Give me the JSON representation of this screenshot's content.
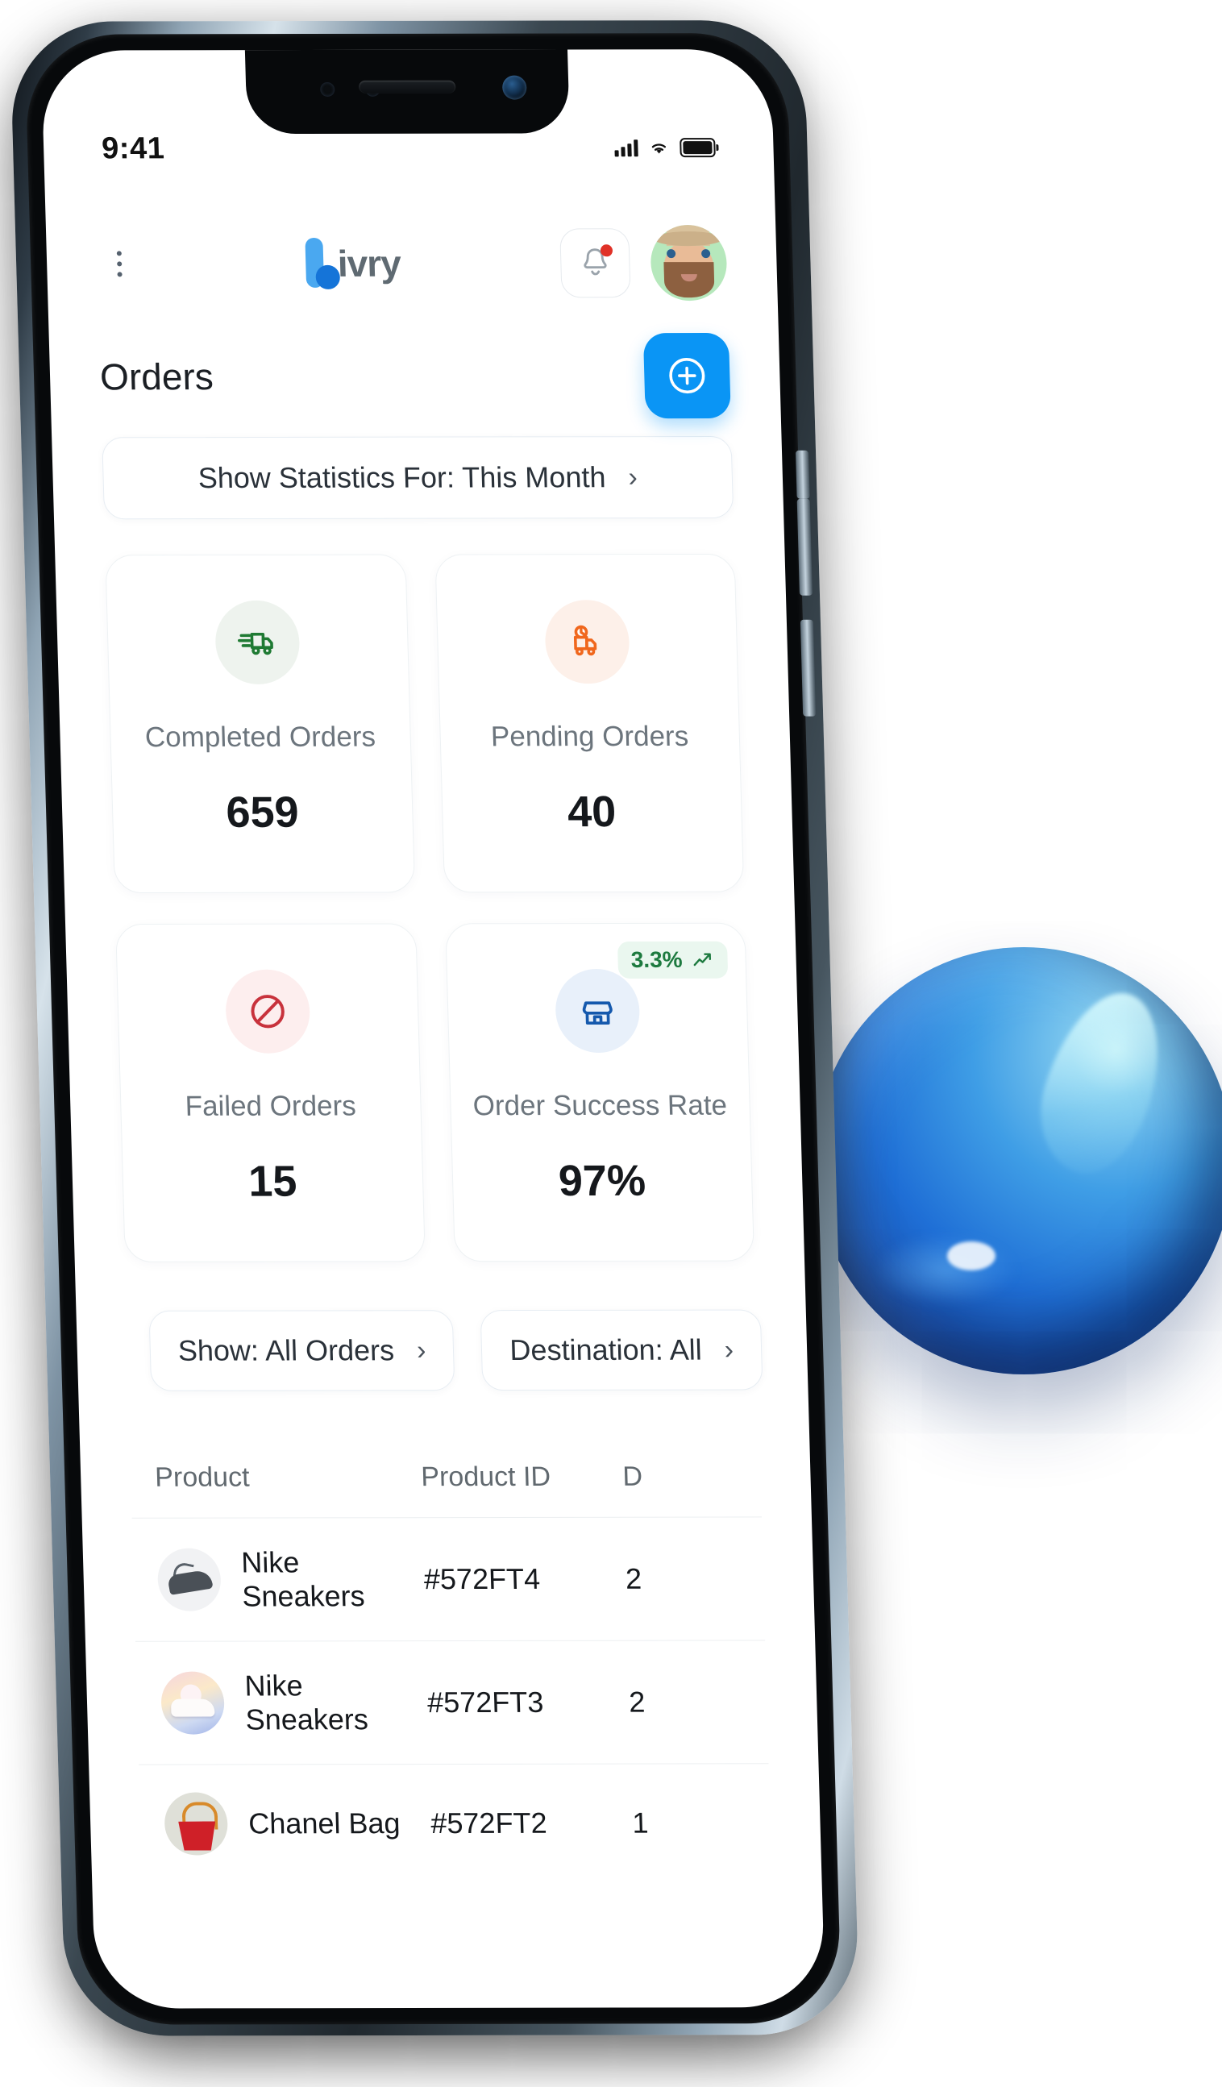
{
  "status_bar": {
    "time": "9:41",
    "signal_icon": "cellular-signal-icon",
    "wifi_icon": "wifi-icon",
    "battery_icon": "battery-icon"
  },
  "header": {
    "menu_icon": "kebab-menu-icon",
    "logo_text": "ivry",
    "logo_full": "Livry",
    "bell_icon": "notification-bell-icon",
    "has_notification": true,
    "avatar_label": "user-avatar"
  },
  "page": {
    "title": "Orders",
    "add_button_icon": "plus-circle-icon"
  },
  "stats_filter": {
    "label": "Show Statistics For: This Month",
    "chevron": "›"
  },
  "stat_cards": [
    {
      "id": "completed-orders",
      "icon": "delivery-truck-icon",
      "label": "Completed Orders",
      "value": "659",
      "icon_color": "#1f7a33",
      "icon_bg": "#eef3ee"
    },
    {
      "id": "pending-orders",
      "icon": "truck-clock-icon",
      "label": "Pending Orders",
      "value": "40",
      "icon_color": "#f0671d",
      "icon_bg": "#fdf0e9"
    },
    {
      "id": "failed-orders",
      "icon": "ban-icon",
      "label": "Failed Orders",
      "value": "15",
      "icon_color": "#c8323c",
      "icon_bg": "#fdeeee"
    },
    {
      "id": "order-success-rate",
      "icon": "store-icon",
      "label": "Order Success Rate",
      "value": "97%",
      "icon_color": "#1559ad",
      "icon_bg": "#e8f0fa",
      "badge_text": "3.3%",
      "badge_icon": "trend-up-icon",
      "badge_color": "#1d7a3f",
      "badge_bg": "#eaf7ef"
    }
  ],
  "filters": [
    {
      "id": "show-filter",
      "label": "Show: All Orders",
      "chevron": "›"
    },
    {
      "id": "destination-filter",
      "label": "Destination: All",
      "chevron": "›"
    }
  ],
  "table": {
    "columns": [
      "Product",
      "Product ID",
      "D"
    ],
    "rows": [
      {
        "thumb": "nike-sneaker-black-thumb",
        "product": "Nike Sneakers",
        "product_id": "#572FT4",
        "date": "2"
      },
      {
        "thumb": "nike-sneaker-pastel-thumb",
        "product": "Nike Sneakers",
        "product_id": "#572FT3",
        "date": "2"
      },
      {
        "thumb": "chanel-bag-red-thumb",
        "product": "Chanel Bag",
        "product_id": "#572FT2",
        "date": "1"
      }
    ]
  },
  "colors": {
    "accent": "#0a95f5",
    "logo_light": "#4aa8f0",
    "logo_dark": "#1574d8",
    "text_primary": "#15181c",
    "text_muted": "#6c757d"
  }
}
